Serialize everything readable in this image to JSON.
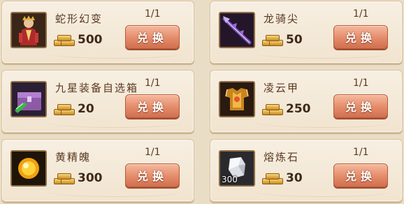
{
  "items": [
    {
      "name": "蛇形幻变",
      "limit": "1/1",
      "cost": "500",
      "button": "兑换",
      "icon": "character-avatar-icon",
      "badge": ""
    },
    {
      "name": "龙骑尖",
      "limit": "1/1",
      "cost": "50",
      "button": "兑换",
      "icon": "dragon-spear-icon",
      "badge": ""
    },
    {
      "name": "九星装备自选箱",
      "limit": "1/1",
      "cost": "20",
      "button": "兑换",
      "icon": "purple-chest-icon",
      "badge": ""
    },
    {
      "name": "凌云甲",
      "limit": "1/1",
      "cost": "250",
      "button": "兑换",
      "icon": "golden-armor-icon",
      "badge": ""
    },
    {
      "name": "黄精魄",
      "limit": "1/1",
      "cost": "300",
      "button": "兑换",
      "icon": "yellow-orb-icon",
      "badge": ""
    },
    {
      "name": "熔炼石",
      "limit": "1/1",
      "cost": "30",
      "button": "兑换",
      "icon": "smelting-stone-icon",
      "badge": "300"
    }
  ],
  "colors": {
    "card_bg": "#f3e8d6",
    "button": "#e48b6a",
    "text": "#5a3a22"
  }
}
